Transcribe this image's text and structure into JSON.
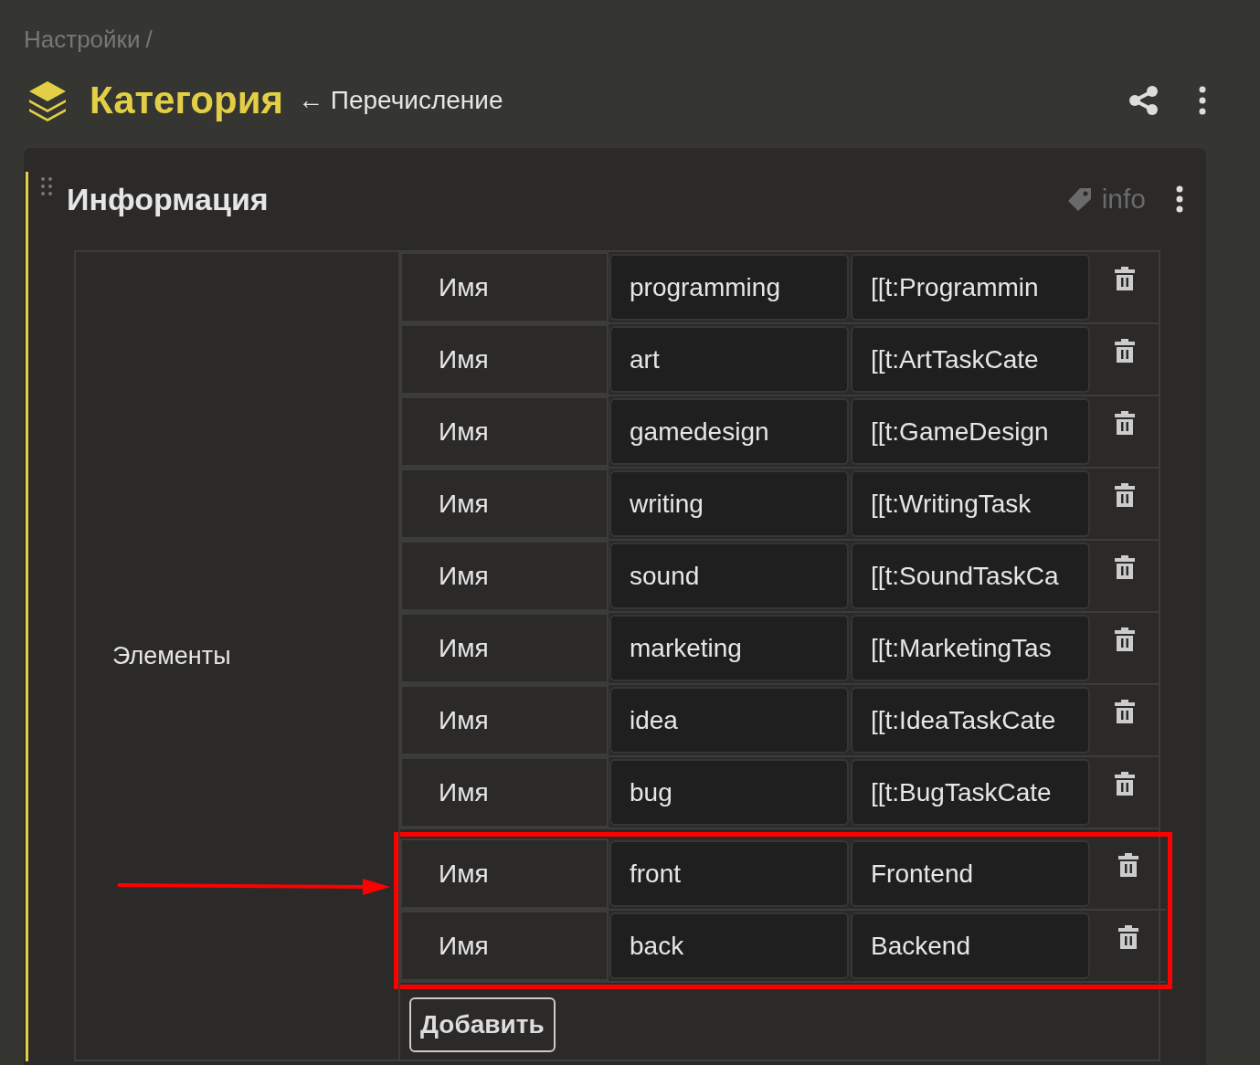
{
  "breadcrumb": {
    "label": "Настройки",
    "separator": "/"
  },
  "header": {
    "title": "Категория",
    "subtitle": "← Перечисление"
  },
  "card": {
    "title": "Информация",
    "tag": "info",
    "field_label": "Элементы",
    "rows": [
      {
        "label": "Имя",
        "key": "programming",
        "value": "[[t:Programmin"
      },
      {
        "label": "Имя",
        "key": "art",
        "value": "[[t:ArtTaskCate"
      },
      {
        "label": "Имя",
        "key": "gamedesign",
        "value": "[[t:GameDesign"
      },
      {
        "label": "Имя",
        "key": "writing",
        "value": "[[t:WritingTask"
      },
      {
        "label": "Имя",
        "key": "sound",
        "value": "[[t:SoundTaskCa"
      },
      {
        "label": "Имя",
        "key": "marketing",
        "value": "[[t:MarketingTas"
      },
      {
        "label": "Имя",
        "key": "idea",
        "value": "[[t:IdeaTaskCate"
      },
      {
        "label": "Имя",
        "key": "bug",
        "value": "[[t:BugTaskCate"
      }
    ],
    "highlighted_rows": [
      {
        "label": "Имя",
        "key": "front",
        "value": "Frontend"
      },
      {
        "label": "Имя",
        "key": "back",
        "value": "Backend"
      }
    ],
    "add_button": "Добавить"
  }
}
